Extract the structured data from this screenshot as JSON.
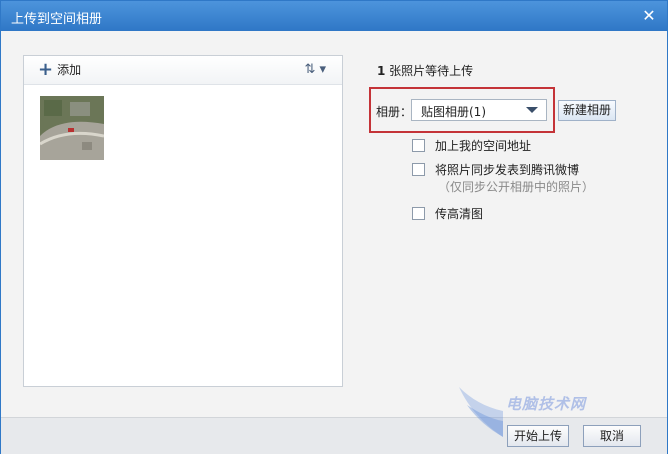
{
  "window": {
    "title": "上传到空间相册",
    "close_glyph": "✕"
  },
  "left_panel": {
    "add_label": "添加",
    "sort_glyph": "⇅ ▾"
  },
  "upload_status": {
    "count": "1",
    "text": " 张照片等待上传"
  },
  "album": {
    "label": "相册：",
    "selected": "贴图相册(1)",
    "new_button": "新建相册"
  },
  "options": [
    {
      "label": "加上我的空间地址",
      "checked": false
    },
    {
      "label": "将照片同步发表到腾讯微博",
      "checked": false
    },
    {
      "label": "传高清图",
      "checked": false
    }
  ],
  "option_note": "（仅同步公开相册中的照片）",
  "footer": {
    "start_label": "开始上传",
    "cancel_label": "取消"
  },
  "watermark": "电脑技术网",
  "colors": {
    "titlebar": "#2f77c6",
    "highlight": "#c43338"
  },
  "icons": {
    "add": "plus-icon",
    "sort": "sort-icon",
    "close": "close-icon"
  }
}
